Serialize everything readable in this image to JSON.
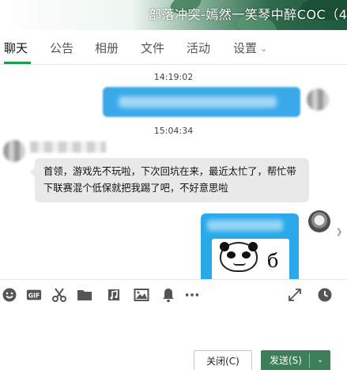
{
  "window": {
    "title": "部落冲突-嫣然一笑琴中醉COC（4"
  },
  "tabs": [
    {
      "label": "聊天"
    },
    {
      "label": "公告"
    },
    {
      "label": "相册"
    },
    {
      "label": "文件"
    },
    {
      "label": "活动"
    },
    {
      "label": "设置"
    }
  ],
  "chat": {
    "time_1": "14:19:02",
    "time_2": "15:04:34",
    "incoming_message": "首领，游戏先不玩啦，下次回坑在来，最近太忙了，帮忙带下联赛混个低保就把我踢了吧，不好意思啦"
  },
  "toolbar": {
    "icons": [
      "emoji-icon",
      "gif-icon",
      "scissors-icon",
      "folder-icon",
      "music-icon",
      "image-icon",
      "bell-icon",
      "more-icon",
      "expand-icon",
      "history-icon"
    ]
  },
  "actions": {
    "close_label": "关闭(C)",
    "send_label": "发送(S)"
  },
  "colors": {
    "accent_green": "#1a9d50",
    "send_button": "#3d7f58",
    "outgoing_bubble": "#3aa9ea",
    "incoming_bubble": "#e9e9e9"
  }
}
